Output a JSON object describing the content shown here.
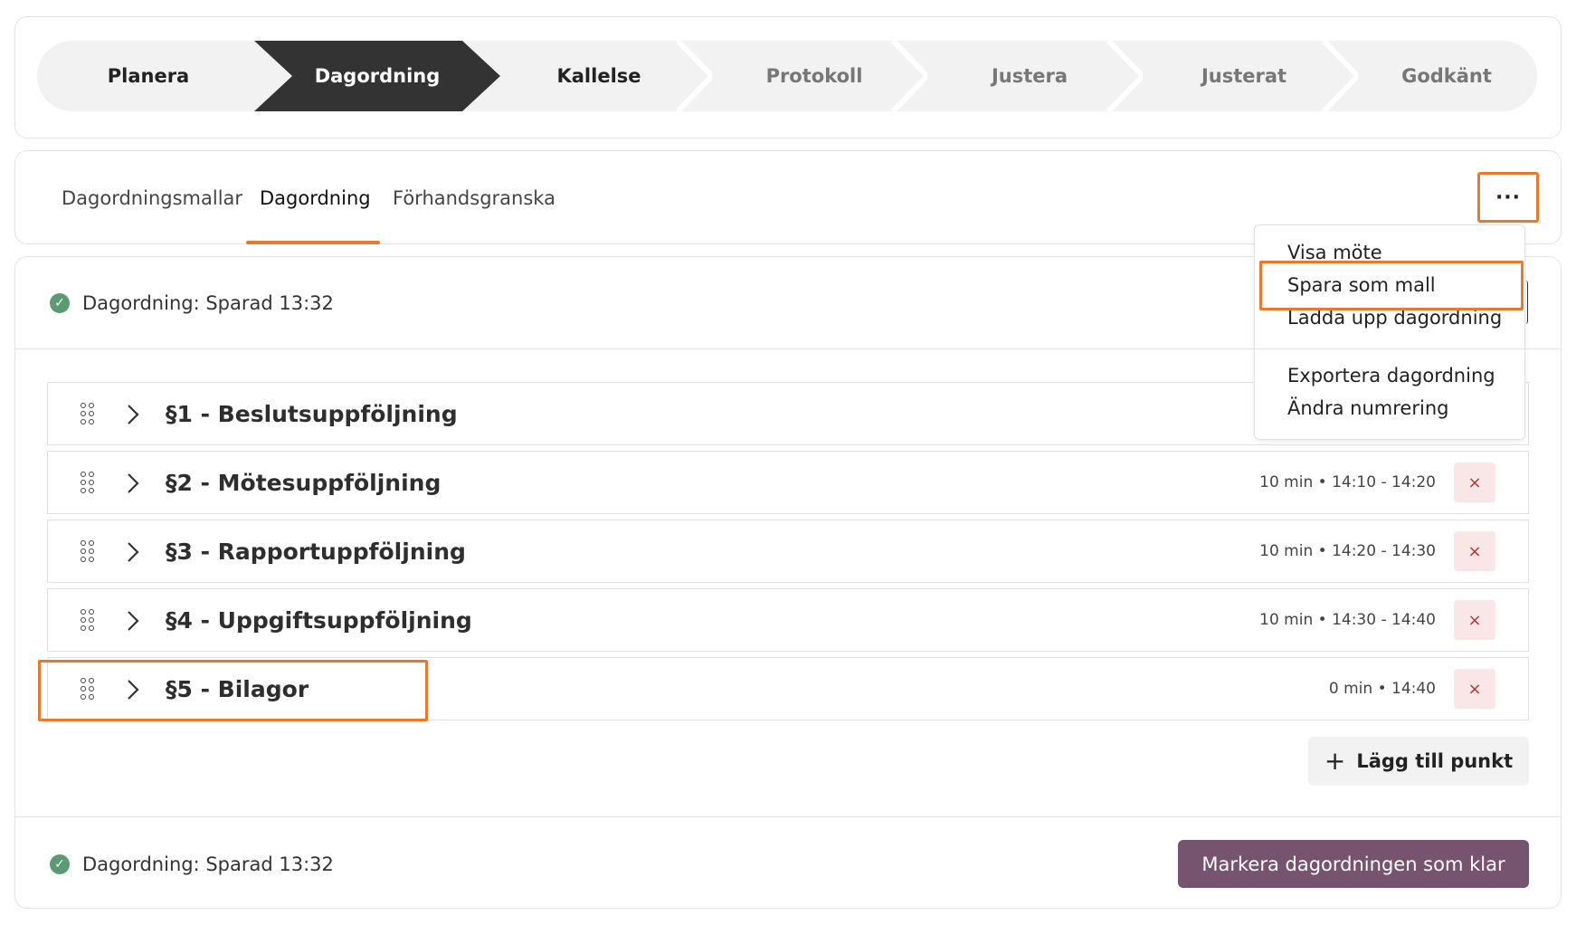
{
  "stepper": {
    "steps": [
      {
        "label": "Planera",
        "state": "done"
      },
      {
        "label": "Dagordning",
        "state": "active"
      },
      {
        "label": "Kallelse",
        "state": "done"
      },
      {
        "label": "Protokoll",
        "state": "todo"
      },
      {
        "label": "Justera",
        "state": "todo"
      },
      {
        "label": "Justerat",
        "state": "todo"
      },
      {
        "label": "Godkänt",
        "state": "todo"
      }
    ],
    "active_color": "#333333"
  },
  "tabs": {
    "items": [
      "Dagordningsmallar",
      "Dagordning",
      "Förhandsgranska"
    ],
    "active": "Dagordning",
    "more_label": "···"
  },
  "menu": {
    "items": [
      "Visa möte",
      "Spara som mall",
      "Ladda upp dagordning",
      "Exportera dagordning",
      "Ändra numrering"
    ],
    "highlighted": "Spara som mall"
  },
  "status": {
    "top": "Dagordning: Sparad 13:32",
    "bottom": "Dagordning: Sparad 13:32"
  },
  "agenda": {
    "items": [
      {
        "title": "§1 - Beslutsuppföljning",
        "time": ""
      },
      {
        "title": "§2 - Mötesuppföljning",
        "time": "10 min • 14:10 - 14:20"
      },
      {
        "title": "§3 - Rapportuppföljning",
        "time": "10 min • 14:20 - 14:30"
      },
      {
        "title": "§4 - Uppgiftsuppföljning",
        "time": "10 min • 14:30 - 14:40"
      },
      {
        "title": "§5 - Bilagor",
        "time": "0 min • 14:40"
      }
    ],
    "delete_icon": "×",
    "add_label": "Lägg till punkt",
    "done_label": "Markera dagordningen som klar"
  },
  "colors": {
    "accent": "#e8792f",
    "primary_button": "#76546f",
    "success": "#5c9a73",
    "delete_bg": "#f9e7e7",
    "delete_fg": "#b23434"
  }
}
